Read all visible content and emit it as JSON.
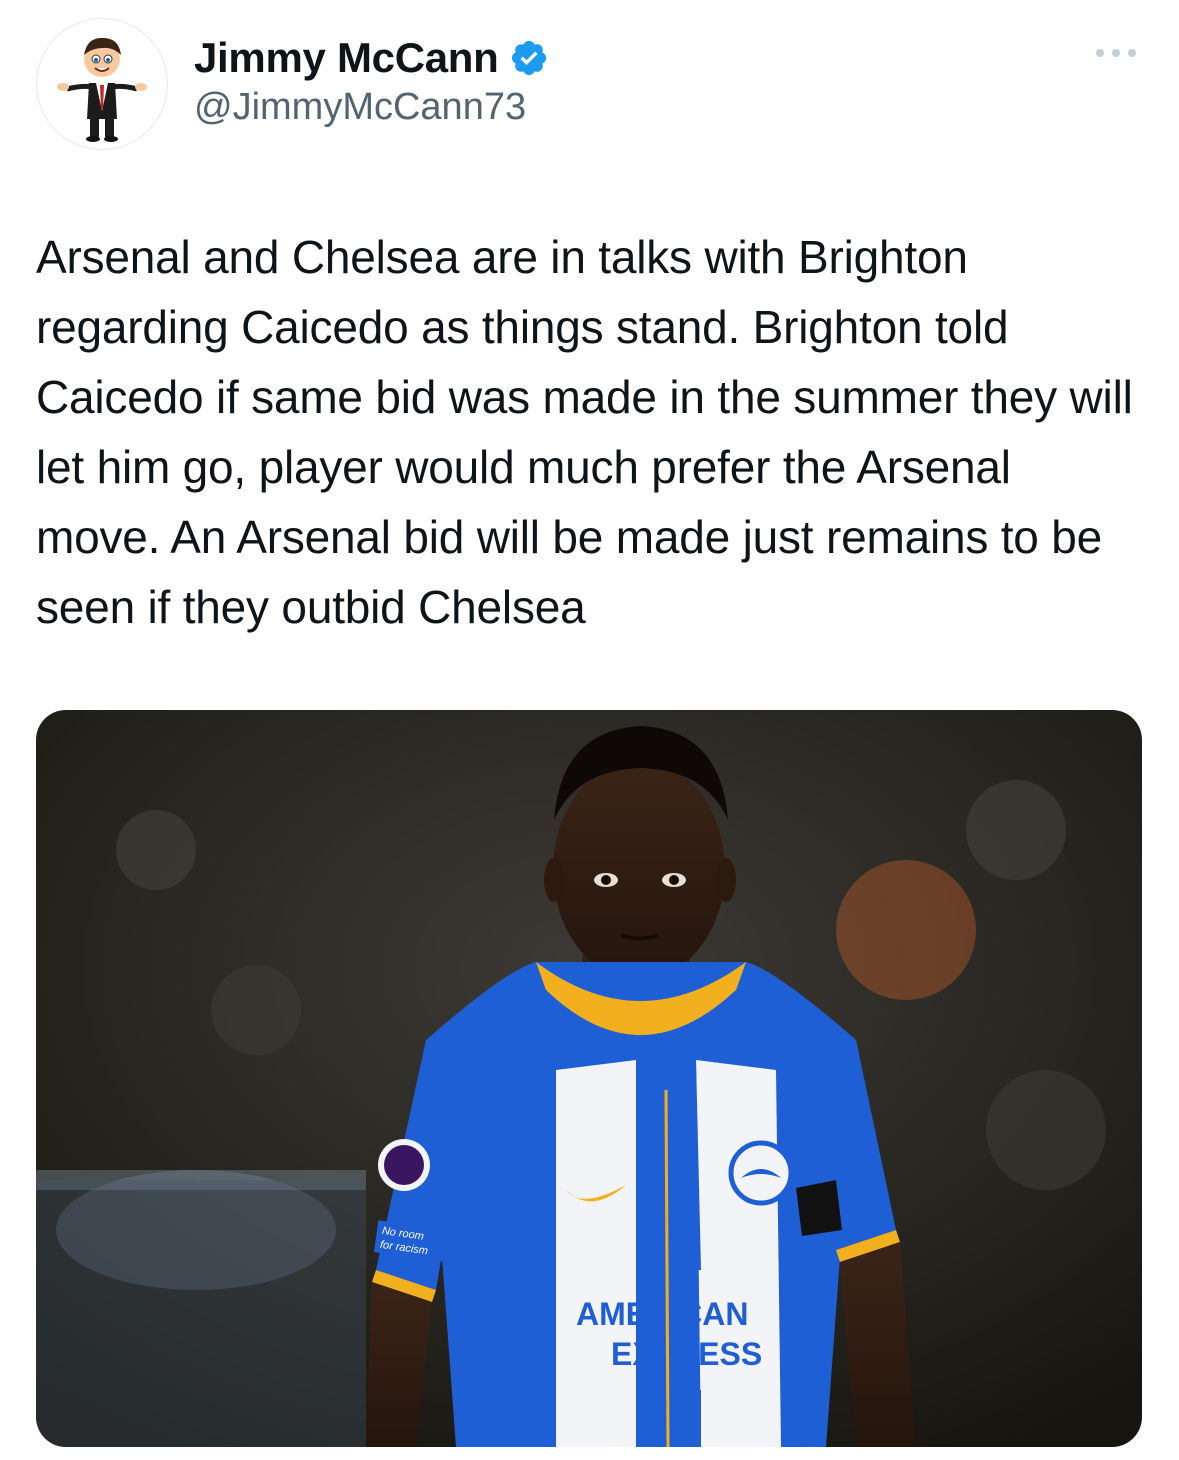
{
  "author": {
    "display_name": "Jimmy McCann",
    "handle": "@JimmyMcCann73",
    "verified": true,
    "avatar_icon": "cartoon-businessman-avatar"
  },
  "tweet": {
    "text": "Arsenal and Chelsea are in talks with Brighton regarding Caicedo as things stand. Brighton told Caicedo if same bid was made in the summer they will let him go, player would much prefer the Arsenal move. An Arsenal bid will be made just remains to be seen if they outbid Chelsea"
  },
  "media": {
    "kind": "photo",
    "shirt_sponsor_line1": "AMERICAN",
    "shirt_sponsor_line2": "EXPRESS",
    "sleeve_patch_line1": "No room",
    "sleeve_patch_line2": "for racism"
  },
  "icons": {
    "verified": "verified-badge-icon",
    "more": "more-options-icon"
  },
  "colors": {
    "verified_blue": "#1d9bf0",
    "text_primary": "#0f1419",
    "text_secondary": "#536471",
    "kit_blue": "#1f5fd6",
    "kit_yellow": "#f2b01e"
  }
}
